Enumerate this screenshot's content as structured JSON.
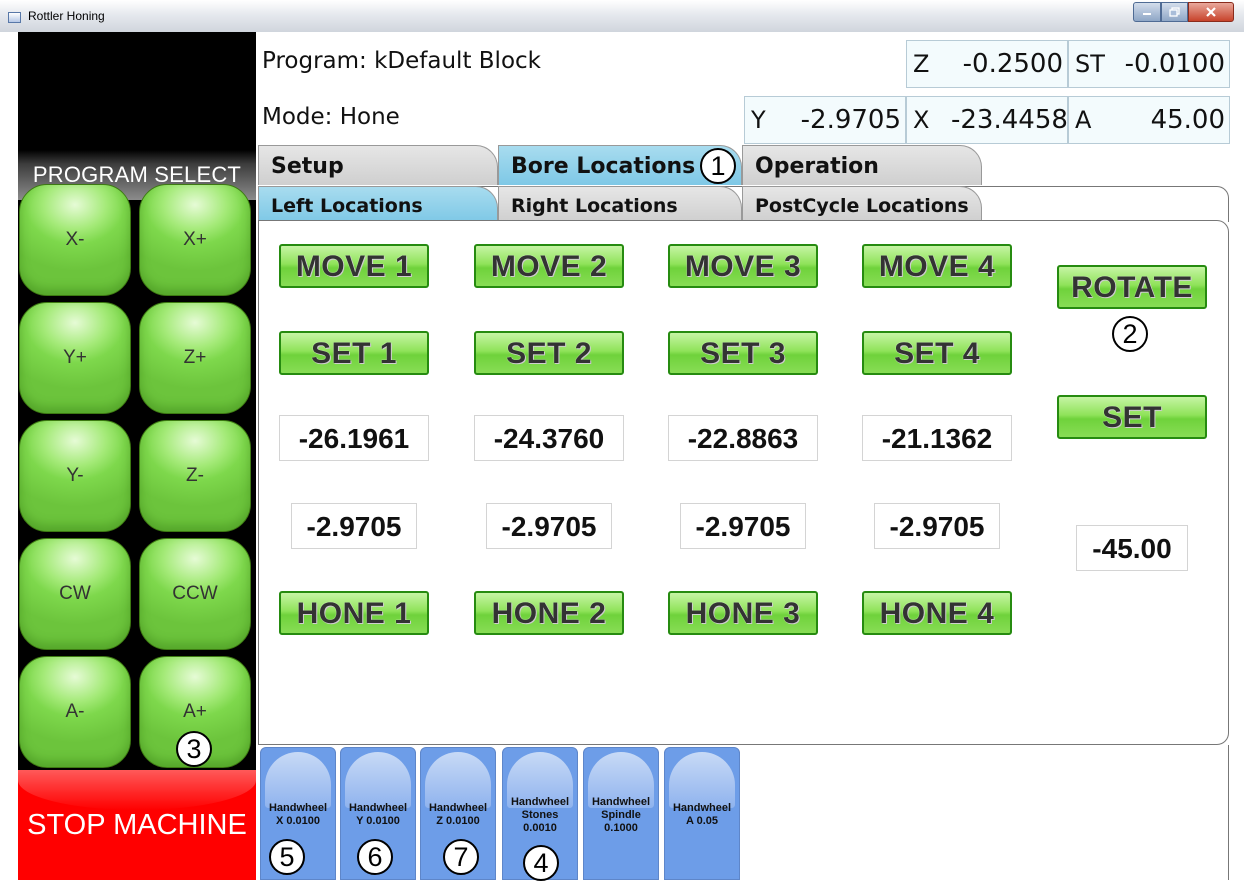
{
  "window": {
    "title": "Rottler Honing"
  },
  "left_panel": {
    "program_select": "PROGRAM SELECT",
    "jog_buttons": [
      "X-",
      "X+",
      "Y+",
      "Z+",
      "Y-",
      "Z-",
      "CW",
      "CCW",
      "A-",
      "A+"
    ],
    "stop": "STOP MACHINE"
  },
  "status": {
    "program": "Program: kDefault Block",
    "mode": "Mode: Hone",
    "readouts": {
      "z": {
        "label": "Z",
        "value": "-0.2500"
      },
      "st": {
        "label": "ST",
        "value": "-0.0100"
      },
      "y": {
        "label": "Y",
        "value": "-2.9705"
      },
      "x": {
        "label": "X",
        "value": "-23.4458"
      },
      "a": {
        "label": "A",
        "value": "45.00"
      }
    }
  },
  "tabs": {
    "main": [
      "Setup",
      "Bore Locations",
      "Operation"
    ],
    "main_active": "Bore Locations",
    "sub": [
      "Left Locations",
      "Right Locations",
      "PostCycle Locations"
    ],
    "sub_active": "Left Locations"
  },
  "locations": {
    "move": [
      "MOVE 1",
      "MOVE 2",
      "MOVE 3",
      "MOVE 4"
    ],
    "set": [
      "SET 1",
      "SET 2",
      "SET 3",
      "SET 4"
    ],
    "x_values": [
      "-26.1961",
      "-24.3760",
      "-22.8863",
      "-21.1362"
    ],
    "y_values": [
      "-2.9705",
      "-2.9705",
      "-2.9705",
      "-2.9705"
    ],
    "hone": [
      "HONE 1",
      "HONE 2",
      "HONE 3",
      "HONE 4"
    ],
    "rotate": "ROTATE",
    "rotate_set": "SET",
    "rotate_value": "-45.00"
  },
  "handwheels": [
    {
      "lines": [
        "Handwheel",
        "X 0.0100"
      ]
    },
    {
      "lines": [
        "Handwheel",
        "Y 0.0100"
      ]
    },
    {
      "lines": [
        "Handwheel",
        "Z 0.0100"
      ]
    },
    {
      "lines": [
        "Handwheel",
        "Stones",
        "0.0010"
      ]
    },
    {
      "lines": [
        "Handwheel",
        "Spindle",
        "0.1000"
      ]
    },
    {
      "lines": [
        "Handwheel",
        "A 0.05"
      ]
    }
  ],
  "markers": [
    "1",
    "2",
    "3",
    "4",
    "5",
    "6",
    "7"
  ]
}
